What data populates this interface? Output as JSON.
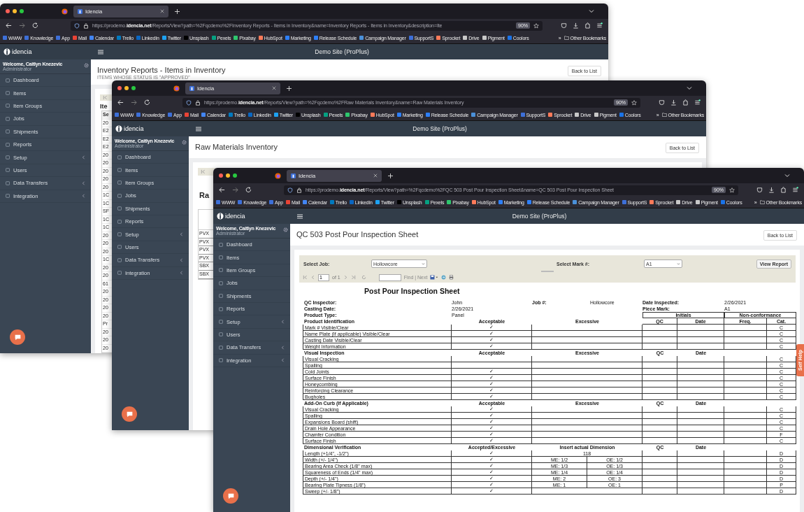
{
  "windows": [
    {
      "tab_title": "Idencia",
      "url": "https://prodemo.**idencia.net**/Reports/View?path=%2Fqcdemo%2FInventory Reports - Items in Inventory&name=Inventory Reports - Items in Inventory&description=Ite",
      "zoom": "90%",
      "bookmarks": [
        {
          "label": "WWW",
          "color": "#3d6fd8"
        },
        {
          "label": "Knowledge",
          "color": "#3d6fd8"
        },
        {
          "label": "App",
          "color": "#3d6fd8"
        },
        {
          "label": "Mail",
          "color": "#ea4335"
        },
        {
          "label": "Calendar",
          "color": "#4285f4"
        },
        {
          "label": "Trello",
          "color": "#0079bf"
        },
        {
          "label": "LinkedIn",
          "color": "#0a66c2"
        },
        {
          "label": "Twitter",
          "color": "#1da1f2"
        },
        {
          "label": "Unsplash",
          "color": "#000000"
        },
        {
          "label": "Pexels",
          "color": "#05a081"
        },
        {
          "label": "Pixabay",
          "color": "#2ec66d"
        },
        {
          "label": "HubSpot",
          "color": "#ff7a59"
        },
        {
          "label": "Marketing",
          "color": "#2d7ff9"
        },
        {
          "label": "Release Schedule",
          "color": "#2d7ff9"
        },
        {
          "label": "Campaign Manager",
          "color": "#4a90d9"
        },
        {
          "label": "SupportS",
          "color": "#3d6fd8"
        },
        {
          "label": "Sprocket",
          "color": "#ff7a59"
        },
        {
          "label": "Drive",
          "color": "#c8c8c8"
        },
        {
          "label": "Pigment",
          "color": "#c8c8c8"
        },
        {
          "label": "Coolors",
          "color": "#1a73e8"
        }
      ],
      "bookmarks_overflow": "»",
      "other_bookmarks": "Other Bookmarks",
      "brand": "idencia",
      "site_title": "Demo Site (ProPlus)",
      "welcome": "Welcome, Caitlyn Knezevic",
      "role": "Administrator",
      "nav": [
        {
          "label": "Dashboard",
          "has_submenu": false
        },
        {
          "label": "Items",
          "has_submenu": false
        },
        {
          "label": "Item Groups",
          "has_submenu": false
        },
        {
          "label": "Jobs",
          "has_submenu": false
        },
        {
          "label": "Shipments",
          "has_submenu": false
        },
        {
          "label": "Reports",
          "has_submenu": false
        },
        {
          "label": "Setup",
          "has_submenu": true
        },
        {
          "label": "Users",
          "has_submenu": false
        },
        {
          "label": "Data Transfers",
          "has_submenu": true
        },
        {
          "label": "Integration",
          "has_submenu": true
        }
      ],
      "page": {
        "title": "Inventory Reports - Items in Inventory",
        "subtitle": "ITEMS WHOSE STATUS IS \"APPROVED\"",
        "back_button": "Back to List",
        "report": {
          "kind": "fragment",
          "heading": "Ite",
          "column_header": "Se",
          "cells": [
            "20",
            "E2",
            "E2",
            "E2",
            "20",
            "20",
            "20",
            "20",
            "20",
            "1C",
            "1C",
            "SF",
            "1C",
            "1C",
            "20",
            "20",
            "20",
            "1C",
            "20",
            "20",
            "61",
            "20",
            "20",
            "20",
            "20",
            "Pr",
            "20",
            "20",
            "20"
          ]
        }
      }
    },
    {
      "tab_title": "Idencia",
      "url": "https://prodemo.**idencia.net**/Reports/View?path=%2Fqcdemo%2FRaw Materials Inventory&name=Raw Materials Inventory",
      "zoom": "90%",
      "bookmarks": [
        {
          "label": "WWW",
          "color": "#3d6fd8"
        },
        {
          "label": "Knowledge",
          "color": "#3d6fd8"
        },
        {
          "label": "App",
          "color": "#3d6fd8"
        },
        {
          "label": "Mail",
          "color": "#ea4335"
        },
        {
          "label": "Calendar",
          "color": "#4285f4"
        },
        {
          "label": "Trello",
          "color": "#0079bf"
        },
        {
          "label": "LinkedIn",
          "color": "#0a66c2"
        },
        {
          "label": "Twitter",
          "color": "#1da1f2"
        },
        {
          "label": "Unsplash",
          "color": "#000000"
        },
        {
          "label": "Pexels",
          "color": "#05a081"
        },
        {
          "label": "Pixabay",
          "color": "#2ec66d"
        },
        {
          "label": "HubSpot",
          "color": "#ff7a59"
        },
        {
          "label": "Marketing",
          "color": "#2d7ff9"
        },
        {
          "label": "Release Schedule",
          "color": "#2d7ff9"
        },
        {
          "label": "Campaign Manager",
          "color": "#4a90d9"
        },
        {
          "label": "SupportS",
          "color": "#3d6fd8"
        },
        {
          "label": "Sprocket",
          "color": "#ff7a59"
        },
        {
          "label": "Drive",
          "color": "#c8c8c8"
        },
        {
          "label": "Pigment",
          "color": "#c8c8c8"
        },
        {
          "label": "Coolors",
          "color": "#1a73e8"
        }
      ],
      "bookmarks_overflow": "»",
      "other_bookmarks": "Other Bookmarks",
      "brand": "idencia",
      "site_title": "Demo Site (ProPlus)",
      "welcome": "Welcome, Caitlyn Knezevic",
      "role": "Administrator",
      "nav": [
        {
          "label": "Dashboard",
          "has_submenu": false
        },
        {
          "label": "Items",
          "has_submenu": false
        },
        {
          "label": "Item Groups",
          "has_submenu": false
        },
        {
          "label": "Jobs",
          "has_submenu": false
        },
        {
          "label": "Shipments",
          "has_submenu": false
        },
        {
          "label": "Reports",
          "has_submenu": false
        },
        {
          "label": "Setup",
          "has_submenu": true
        },
        {
          "label": "Users",
          "has_submenu": false
        },
        {
          "label": "Data Transfers",
          "has_submenu": true
        },
        {
          "label": "Integration",
          "has_submenu": true
        }
      ],
      "page": {
        "title": "Raw Materials Inventory",
        "back_button": "Back to List",
        "report": {
          "kind": "fragment",
          "heading": "Ra",
          "cells": [
            "PVX",
            "PVX",
            "PVX",
            "PVX",
            "SBX",
            "SBX"
          ]
        }
      }
    },
    {
      "tab_title": "Idencia",
      "url": "https://prodemo.**idencia.net**/Reports/View?path=%2Fqcdemo%2FQC 503 Post Pour Inspection Sheet&name=QC 503 Post Pour Inspection Sheet",
      "zoom": "90%",
      "bookmarks": [
        {
          "label": "WWW",
          "color": "#3d6fd8"
        },
        {
          "label": "Knowledge",
          "color": "#3d6fd8"
        },
        {
          "label": "App",
          "color": "#3d6fd8"
        },
        {
          "label": "Mail",
          "color": "#ea4335"
        },
        {
          "label": "Calendar",
          "color": "#4285f4"
        },
        {
          "label": "Trello",
          "color": "#0079bf"
        },
        {
          "label": "LinkedIn",
          "color": "#0a66c2"
        },
        {
          "label": "Twitter",
          "color": "#1da1f2"
        },
        {
          "label": "Unsplash",
          "color": "#000000"
        },
        {
          "label": "Pexels",
          "color": "#05a081"
        },
        {
          "label": "Pixabay",
          "color": "#2ec66d"
        },
        {
          "label": "HubSpot",
          "color": "#ff7a59"
        },
        {
          "label": "Marketing",
          "color": "#2d7ff9"
        },
        {
          "label": "Release Schedule",
          "color": "#2d7ff9"
        },
        {
          "label": "Campaign Manager",
          "color": "#4a90d9"
        },
        {
          "label": "SupportS",
          "color": "#3d6fd8"
        },
        {
          "label": "Sprocket",
          "color": "#ff7a59"
        },
        {
          "label": "Drive",
          "color": "#c8c8c8"
        },
        {
          "label": "Pigment",
          "color": "#c8c8c8"
        },
        {
          "label": "Coolors",
          "color": "#1a73e8"
        }
      ],
      "bookmarks_overflow": "»",
      "other_bookmarks": "Other Bookmarks",
      "brand": "idencia",
      "site_title": "Demo Site (ProPlus)",
      "welcome": "Welcome, Caitlyn Knezevic",
      "role": "Administrator",
      "nav": [
        {
          "label": "Dashboard",
          "has_submenu": false
        },
        {
          "label": "Items",
          "has_submenu": false
        },
        {
          "label": "Item Groups",
          "has_submenu": false
        },
        {
          "label": "Jobs",
          "has_submenu": false
        },
        {
          "label": "Shipments",
          "has_submenu": false
        },
        {
          "label": "Reports",
          "has_submenu": false
        },
        {
          "label": "Setup",
          "has_submenu": true
        },
        {
          "label": "Users",
          "has_submenu": false
        },
        {
          "label": "Data Transfers",
          "has_submenu": true
        },
        {
          "label": "Integration",
          "has_submenu": true
        }
      ],
      "self_help": "Self Help",
      "page": {
        "title": "QC 503 Post Pour Inspection Sheet",
        "back_button": "Back to List",
        "report": {
          "kind": "inspection_sheet",
          "filters": {
            "job_label": "Select Job:",
            "job_value": "Hollowcore",
            "mark_label": "Select Mark #:",
            "mark_value": "A1",
            "button": "View Report"
          },
          "pager": {
            "page": "1",
            "page_count": "of 1",
            "find": "Find | Next"
          },
          "title": "Post Pour Inspection Sheet",
          "inspector": {
            "label": "QC Inspector:",
            "value": "John"
          },
          "job": {
            "label": "Job #:",
            "value": "Hollowcore"
          },
          "date_inspected": {
            "label": "Date Inspected:",
            "value": "2/26/2021"
          },
          "casting_date": {
            "label": "Casting Date:",
            "value": "2/26/2021"
          },
          "piece_mark": {
            "label": "Piece Mark:",
            "value": "A1"
          },
          "product_type": {
            "label": "Product Type:",
            "value": "Panel"
          },
          "group_headers": [
            "Initials",
            "Non-conformance"
          ],
          "sections": [
            {
              "title": "Product Identification",
              "columns": [
                "Acceptable",
                "Excessive",
                "QC",
                "Date",
                "Freq.",
                "Cat."
              ],
              "rows": [
                {
                  "kind": "check",
                  "label": "Mark # Visible/Clear",
                  "acceptable": "✓",
                  "cat": "C"
                },
                {
                  "kind": "check",
                  "label": "Name Plate (If applicable) Visible/Clear",
                  "acceptable": "✓",
                  "cat": "C"
                },
                {
                  "kind": "check",
                  "label": "Casting Date Visible/Clear",
                  "acceptable": "✓",
                  "cat": "C"
                },
                {
                  "kind": "check",
                  "label": "Weight Information",
                  "acceptable": "✓",
                  "cat": "C"
                }
              ]
            },
            {
              "title": "Visual Inspection",
              "columns": [
                "Acceptable",
                "Excessive",
                "QC",
                "Date"
              ],
              "rows": [
                {
                  "kind": "check",
                  "label": "Visual Cracking",
                  "cat": "C"
                },
                {
                  "kind": "check",
                  "label": "Spalling",
                  "cat": "C"
                },
                {
                  "kind": "check",
                  "label": "Cold Joints",
                  "acceptable": "✓",
                  "cat": "C"
                },
                {
                  "kind": "check",
                  "label": "Surface Finish",
                  "acceptable": "✓",
                  "cat": "C"
                },
                {
                  "kind": "check",
                  "label": "Honeycombing",
                  "acceptable": "✓",
                  "cat": "C"
                },
                {
                  "kind": "check",
                  "label": "Reinforcing Clearance",
                  "acceptable": "✓",
                  "cat": "C"
                },
                {
                  "kind": "check",
                  "label": "Bugholes",
                  "acceptable": "✓",
                  "cat": "C"
                }
              ]
            },
            {
              "title": "Add-On Curb (If Applicable)",
              "columns": [
                "Acceptable",
                "Excessive",
                "QC",
                "Date"
              ],
              "rows": [
                {
                  "kind": "check",
                  "label": "Visual Cracking",
                  "acceptable": "✓",
                  "cat": "C"
                },
                {
                  "kind": "check",
                  "label": "Spalling",
                  "acceptable": "✓",
                  "cat": "C"
                },
                {
                  "kind": "check",
                  "label": "Expansions Board (shift)",
                  "acceptable": "✓",
                  "cat": "C"
                },
                {
                  "kind": "check",
                  "label": "Drain Hole Appearance",
                  "acceptable": "✓",
                  "cat": "C"
                },
                {
                  "kind": "check",
                  "label": "Chamfer Condition",
                  "acceptable": "✓",
                  "cat": "F"
                },
                {
                  "kind": "check",
                  "label": "Surface Finish",
                  "acceptable": "✓",
                  "cat": "C"
                }
              ]
            },
            {
              "title": "Dimensional Verification",
              "columns": [
                "Accepted/Excessive",
                "Insert actual Dimension",
                "QC",
                "Date"
              ],
              "rows": [
                {
                  "kind": "single",
                  "label": "Length (+1/4\", -1/2\")",
                  "acceptable": "✓",
                  "value": "118",
                  "cat": "D"
                },
                {
                  "kind": "split",
                  "label": "Width (+/- 1/4\")",
                  "acceptable": "✓",
                  "me": "ME: 1/2",
                  "oe": "OE: 1/2",
                  "cat": "D"
                },
                {
                  "kind": "split",
                  "label": "Bearing Area Check (1/8\" max)",
                  "acceptable": "✓",
                  "me": "ME: 1/3",
                  "oe": "OE: 1/3",
                  "cat": "D"
                },
                {
                  "kind": "split",
                  "label": "Squareness of Ends (1/4\" max)",
                  "acceptable": "✓",
                  "me": "ME: 1/4",
                  "oe": "OE: 1/4",
                  "cat": "D"
                },
                {
                  "kind": "split",
                  "label": "Depth (+/- 1/4\")",
                  "acceptable": "✓",
                  "me": "ME: 2",
                  "oe": "OE: 3",
                  "cat": "D"
                },
                {
                  "kind": "split",
                  "label": "Bearing Plate Tipness (1/8\")",
                  "acceptable": "✓",
                  "me": "ME: 1",
                  "oe": "OE: 1",
                  "cat": "P"
                },
                {
                  "kind": "single",
                  "label": "Sweep (+/- 1/8\")",
                  "acceptable": "✓",
                  "cat": "D"
                }
              ]
            }
          ]
        }
      }
    }
  ]
}
